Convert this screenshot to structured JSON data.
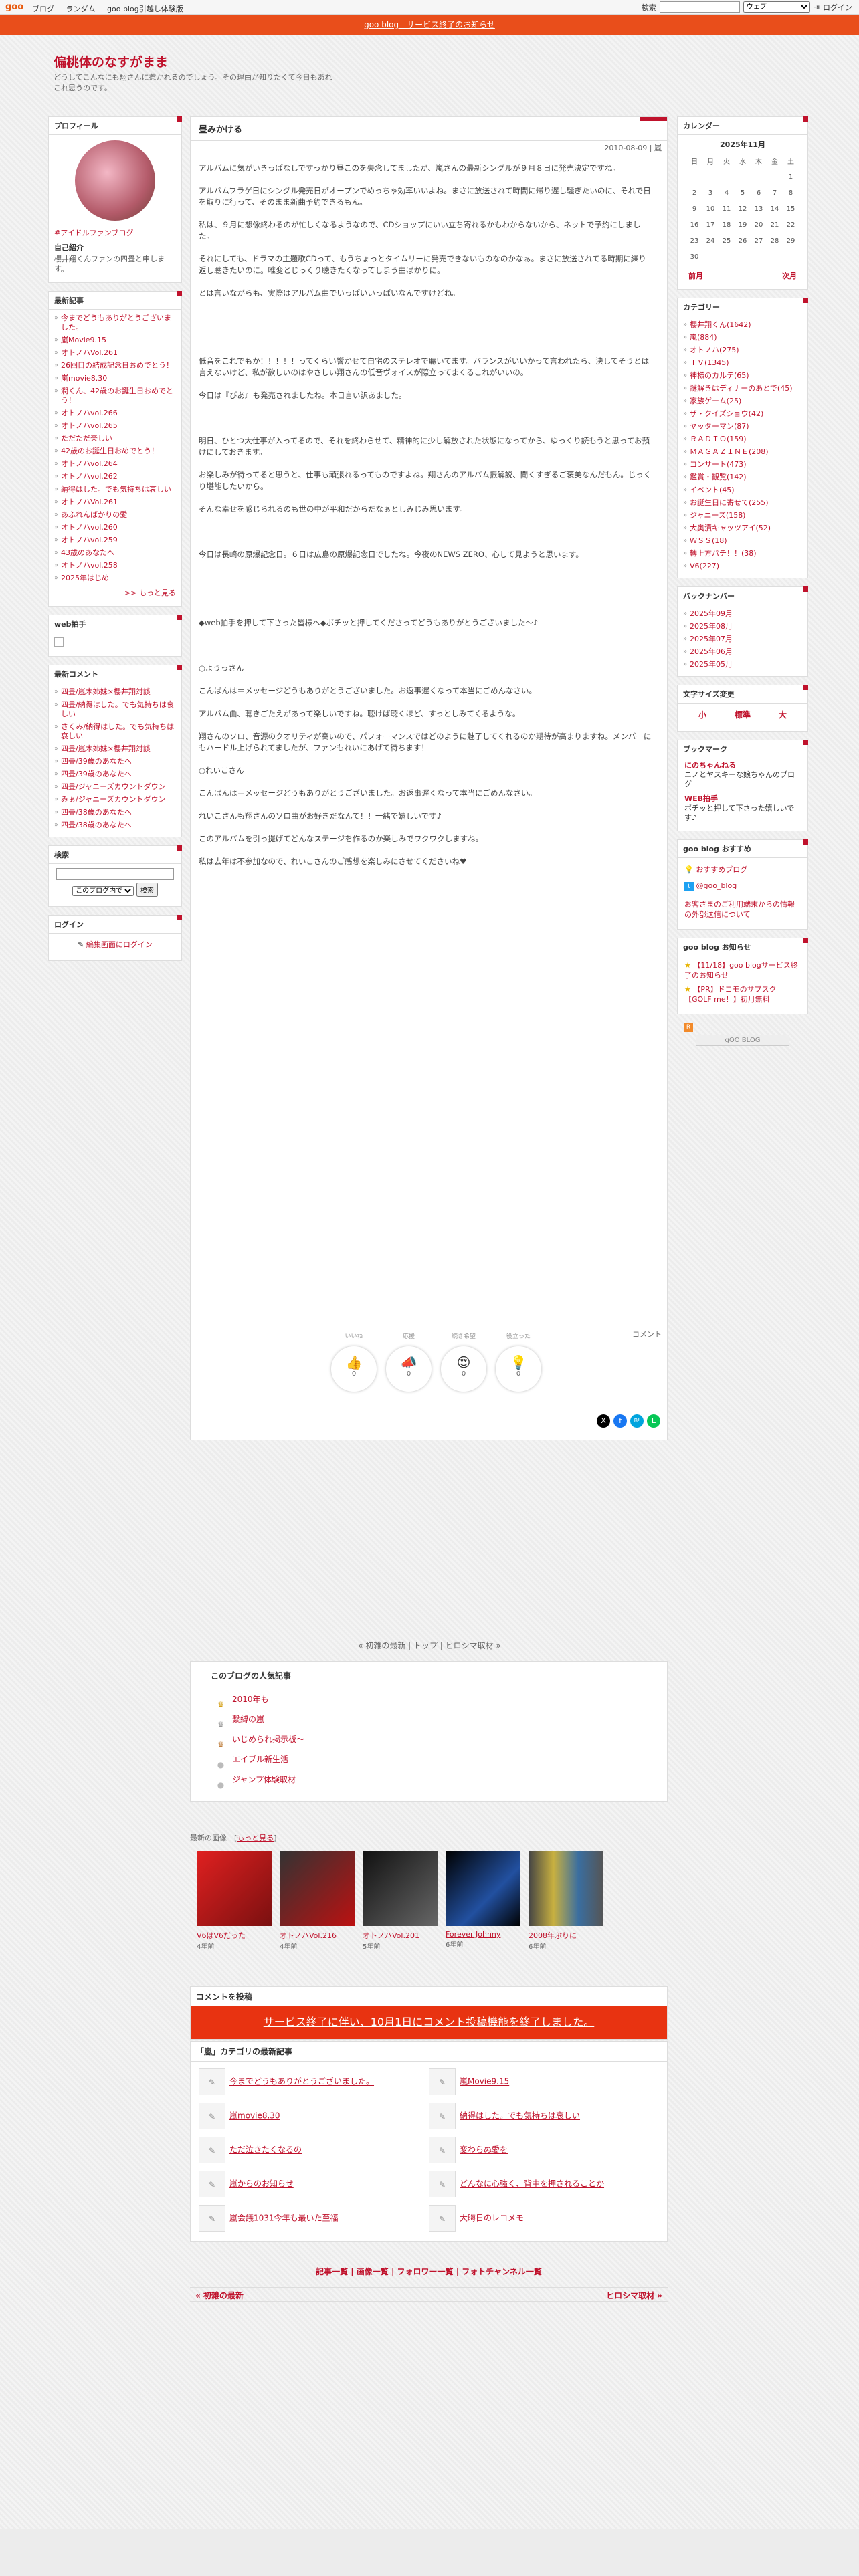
{
  "topbar": {
    "logo": "goo",
    "nav": [
      "ブログ",
      "ランダム",
      "goo blog引越し体験版"
    ],
    "search_label": "検索",
    "search_scope": "ウェブ",
    "login": "ログイン"
  },
  "notice": "goo blog　サービス終了のお知らせ",
  "blog": {
    "title": "偏桃体のなすがまま",
    "desc": "どうしてこんなにも翔さんに惹かれるのでしょう。その理由が知りたくて今日もあれこれ思うのです。"
  },
  "profile": {
    "title": "プロフィール",
    "tag": "#アイドルファンブログ",
    "intro_label": "自己紹介",
    "intro": "櫻井翔くんファンの四畳と申します。"
  },
  "recent_posts": {
    "title": "最新記事",
    "items": [
      "今までどうもありがとうございました。",
      "嵐Movie9.15",
      "オトノハVol.261",
      "26回目の結成記念日おめでとう！",
      "嵐movie8.30",
      "潤くん、42歳のお誕生日おめでとう！",
      "オトノハvol.266",
      "オトノハvol.265",
      "ただただ楽しい",
      "42歳のお誕生日おめでとう！",
      "オトノハvol.264",
      "オトノハvol.262",
      "納得はした。でも気持ちは哀しい",
      "オトノハVol.261",
      "あふれんばかりの愛",
      "オトノハvol.260",
      "オトノハvol.259",
      "43歳のあなたへ",
      "オトノハvol.258",
      "2025年はじめ"
    ],
    "more": ">> もっと見る"
  },
  "web_applause": {
    "title": "web拍手"
  },
  "recent_comments": {
    "title": "最新コメント",
    "items": [
      "四畳/嵐木姉妹×櫻井翔対談",
      "四畳/納得はした。でも気持ちは哀しい",
      "さくみ/納得はした。でも気持ちは哀しい",
      "四畳/嵐木姉妹×櫻井翔対談",
      "四畳/39歳のあなたへ",
      "四畳/39歳のあなたへ",
      "四畳/ジャニーズカウントダウン",
      "みぁ/ジャニーズカウントダウン",
      "四畳/38歳のあなたへ",
      "四畳/38歳のあなたへ"
    ]
  },
  "search": {
    "title": "検索",
    "scope": "このブログ内で",
    "button": "検索"
  },
  "login": {
    "title": "ログイン",
    "link": "編集画面にログイン"
  },
  "post": {
    "title": "昼みかける",
    "date": "2010-08-09 | 嵐",
    "paragraphs": [
      "アルバムに気がいきっぱなしですっかり昼このを失念してましたが、嵐さんの最新シングルが９月８日に発売決定ですね。",
      "アルバムフラゲ日にシングル発売日がオープンでめっちゃ効率いいよね。まさに放送されて時間に帰り遅し騒ぎたいのに、それで日を取りに行って、そのまま新曲予約できるもん。",
      "私は、９月に想像終わるのが忙しくなるようなので、CDショップにいい立ち寄れるかもわからないから、ネットで予約にしました。",
      "それにしても、ドラマの主題歌CDって、もうちょっとタイムリーに発売できないものなのかなぁ。まさに放送されてる時期に繰り返し聴きたいのに。唯変とじっくり聴きたくなってしまう曲ばかりに。",
      "とは言いながらも、実際はアルバム曲でいっぱいいっぱいなんですけどね。",
      "低音をこれでもか！！！！！ってくらい響かせて自宅のステレオで聴いてます。バランスがいいかって言われたら、決してそうとは言えないけど、私が欲しいのはやさしい翔さんの低音ヴォイスが際立ってまくるこれがいいの。",
      "今日は『ぴあ』も発売されましたね。本日言い訳あました。",
      "明日、ひとつ大仕事が入ってるので、それを終わらせて、精神的に少し解放された状態になってから、ゆっくり読もうと思ってお預けにしておきます。",
      "お楽しみが待ってると思うと、仕事も頑張れるってものですよね。翔さんのアルバム振解説、聞くすぎるご褒美なんだもん。じっくり堪能したいから。",
      "そんな幸せを感じられるのも世の中が平和だからだなぁとしみじみ思います。",
      "今日は長崎の原爆記念日。６日は広島の原爆記念日でしたね。今夜のNEWS ZERO、心して見ようと思います。",
      "◆web拍手を押して下さった皆様へ◆ポチッと押してくださってどうもありがとうございました〜♪",
      "○ようっさん",
      "こんばんは＝メッセージどうもありがとうございました。お返事遅くなって本当にごめんなさい。",
      "アルバム曲、聴きごたえがあって楽しいですね。聴けば聴くほど、すっとしみてくるような。",
      "翔さんのソロ、音源のクオリティが高いので、パフォーマンスではどのように魅了してくれるのか期待が高まりますね。メンバーにもハードル上げられてましたが、ファンもれいにあげて待ちます！",
      "○れいこさん",
      "こんばんは＝メッセージどうもありがとうございました。お返事遅くなって本当にごめんなさい。",
      "れいこさんも翔さんのソロ曲がお好きだなんて！！一緒で嬉しいです♪",
      "このアルバムを引っ提げてどんなステージを作るのか楽しみでワクワクしますね。",
      "私は去年は不参加なので、れいこさんのご感想を楽しみにさせてくださいね♥"
    ],
    "comment_link": "コメント",
    "reactions": [
      {
        "label": "いいね",
        "icon": "👍",
        "count": "0"
      },
      {
        "label": "応援",
        "icon": "📣",
        "count": "0"
      },
      {
        "label": "続き希望",
        "icon": "😍",
        "count": "0"
      },
      {
        "label": "役立った",
        "icon": "💡",
        "count": "0"
      }
    ],
    "share": [
      "X",
      "f",
      "B!",
      "L"
    ]
  },
  "navline": "« 初雑の最新 | トップ | ヒロシマ取材 »",
  "popular": {
    "title": "このブログの人気記事",
    "items": [
      "2010年も",
      "繋縛の嵐",
      "いじめられ掲示板～",
      "エイブル新生活",
      "ジャンプ体験取材"
    ]
  },
  "recent_images": {
    "title": "最新の画像",
    "more": "もっと見る",
    "items": [
      {
        "cap": "V6はV6だった",
        "yr": "4年前"
      },
      {
        "cap": "オトノハVol.216",
        "yr": "4年前"
      },
      {
        "cap": "オトノハVol.201",
        "yr": "5年前"
      },
      {
        "cap": "Forever Johnny",
        "yr": "6年前"
      },
      {
        "cap": "2008年ぶりに",
        "yr": "6年前"
      }
    ]
  },
  "comment_post": {
    "title": "コメントを投稿",
    "notice": "サービス終了に伴い、10月1日にコメント投稿機能を終了しました。"
  },
  "cat_recent": {
    "title": "「嵐」カテゴリの最新記事",
    "items": [
      "今までどうもありがとうございました。",
      "嵐Movie9.15",
      "嵐movie8.30",
      "納得はした。でも気持ちは哀しい",
      "ただ泣きたくなるの",
      "変わらぬ愛を",
      "嵐からのお知らせ",
      "どんなに心強く、背中を押されることか",
      "嵐会議1031今年も最いた至福",
      "大晦日のレコメモ"
    ]
  },
  "bottom_links": "記事一覧 | 画像一覧 | フォロワー一覧 | フォトチャンネル一覧",
  "prevnext": {
    "prev": "« 初雑の最新",
    "next": "ヒロシマ取材 »"
  },
  "calendar": {
    "title": "カレンダー",
    "month": "2025年11月",
    "weekdays": [
      "日",
      "月",
      "火",
      "水",
      "木",
      "金",
      "土"
    ],
    "weeks": [
      [
        "",
        "",
        "",
        "",
        "",
        "",
        "1"
      ],
      [
        "2",
        "3",
        "4",
        "5",
        "6",
        "7",
        "8"
      ],
      [
        "9",
        "10",
        "11",
        "12",
        "13",
        "14",
        "15"
      ],
      [
        "16",
        "17",
        "18",
        "19",
        "20",
        "21",
        "22"
      ],
      [
        "23",
        "24",
        "25",
        "26",
        "27",
        "28",
        "29"
      ],
      [
        "30",
        "",
        "",
        "",
        "",
        "",
        ""
      ]
    ],
    "prev": "前月",
    "next": "次月"
  },
  "categories": {
    "title": "カテゴリー",
    "items": [
      "櫻井翔くん(1642)",
      "嵐(884)",
      "オトノハ(275)",
      "ＴＶ(1345)",
      "神様のカルテ(65)",
      "謎解きはディナーのあとで(45)",
      "家族ゲーム(25)",
      "ザ・クイズショウ(42)",
      "ヤッターマン(87)",
      "ＲＡＤＩＯ(159)",
      "ＭＡＧＡＺＩＮＥ(208)",
      "コンサート(473)",
      "鑑賞・観覧(142)",
      "イベント(45)",
      "お誕生日に寄せて(255)",
      "ジャニーズ(158)",
      "大奥漬キャッツアイ(52)",
      "ＷＳＳ(18)",
      "轉上方パチ！！(38)",
      "V6(227)"
    ]
  },
  "backnumber": {
    "title": "バックナンバー",
    "items": [
      "2025年09月",
      "2025年08月",
      "2025年07月",
      "2025年06月",
      "2025年05月"
    ]
  },
  "textsize": {
    "title": "文字サイズ変更",
    "items": [
      "小",
      "標準",
      "大"
    ]
  },
  "bookmark": {
    "title": "ブックマーク",
    "items": [
      {
        "name": "にのちゃんねる",
        "desc": "ニノとヤスキーな娘ちゃんのブログ"
      },
      {
        "name": "WEB拍手",
        "desc": "ポチッと押して下さった嬉しいです♪"
      }
    ]
  },
  "goo_recommend": {
    "title": "goo blog おすすめ",
    "items": [
      "おすすめブログ",
      "@goo_blog"
    ],
    "notice": "お客さまのご利用端末からの情報の外部送信について"
  },
  "goo_news": {
    "title": "goo blog お知らせ",
    "items": [
      "【11/18】goo blogサービス終了のお知らせ",
      "【PR】ドコモのサブスク【GOLF me！】初月無料"
    ]
  },
  "footer_badge": "gOO BLOG",
  "colors": {
    "accent": "#c0122c",
    "notice": "#e94e1b"
  }
}
